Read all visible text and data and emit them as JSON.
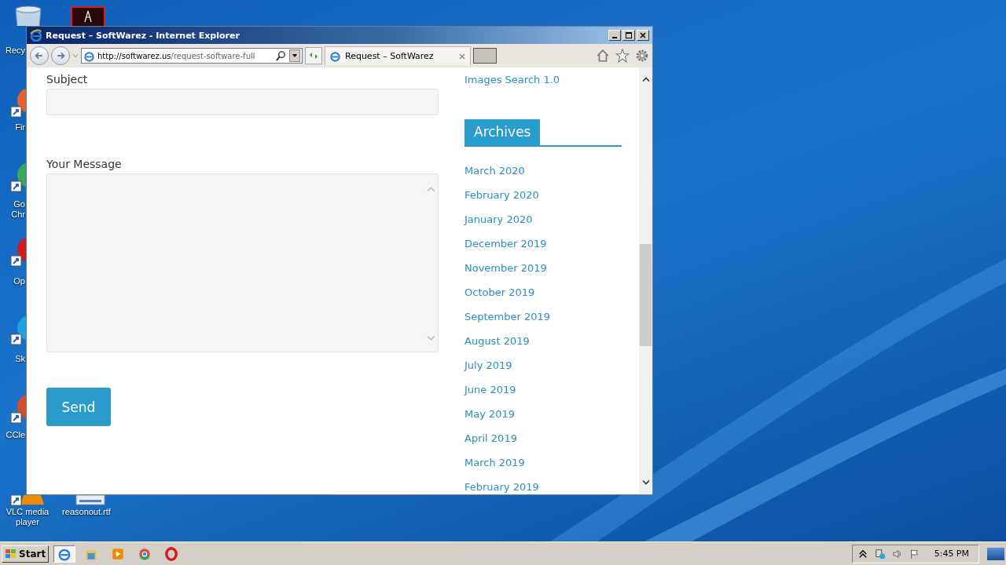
{
  "desktop_icons": [
    {
      "label": "Recy",
      "kind": "recycle"
    },
    {
      "label": "Fir",
      "kind": "firefox"
    },
    {
      "label": "Go Chr",
      "kind": "chrome"
    },
    {
      "label": "Op",
      "kind": "opera"
    },
    {
      "label": "Sk",
      "kind": "skype"
    },
    {
      "label": "CCle",
      "kind": "ccleaner"
    },
    {
      "label": "VLC media player",
      "kind": "vlc"
    },
    {
      "label": "reasonout.rtf",
      "kind": "document"
    }
  ],
  "window": {
    "title": "Request – SoftWarez - Internet Explorer"
  },
  "address_bar": {
    "host": "http://softwarez.us",
    "path": "/request-software-full"
  },
  "tabs": [
    {
      "label": "Request – SoftWarez",
      "selected": true
    }
  ],
  "form": {
    "fields": [
      {
        "label": "Subject",
        "kind": "input"
      },
      {
        "label": "Your Message",
        "kind": "textarea"
      }
    ],
    "submit": "Send"
  },
  "sidebar": {
    "previous_link": "Images Search 1.0",
    "archives_title": "Archives",
    "archives": [
      "March 2020",
      "February 2020",
      "January 2020",
      "December 2019",
      "November 2019",
      "October 2019",
      "September 2019",
      "August 2019",
      "July 2019",
      "June 2019",
      "May 2019",
      "April 2019",
      "March 2019",
      "February 2019"
    ]
  },
  "taskbar": {
    "start": "Start",
    "apps": [
      {
        "kind": "ie",
        "selected": true
      },
      {
        "kind": "explorer",
        "selected": false
      },
      {
        "kind": "media",
        "selected": false
      },
      {
        "kind": "chrome",
        "selected": false
      },
      {
        "kind": "opera",
        "selected": false
      }
    ],
    "clock": "5:45 PM"
  }
}
